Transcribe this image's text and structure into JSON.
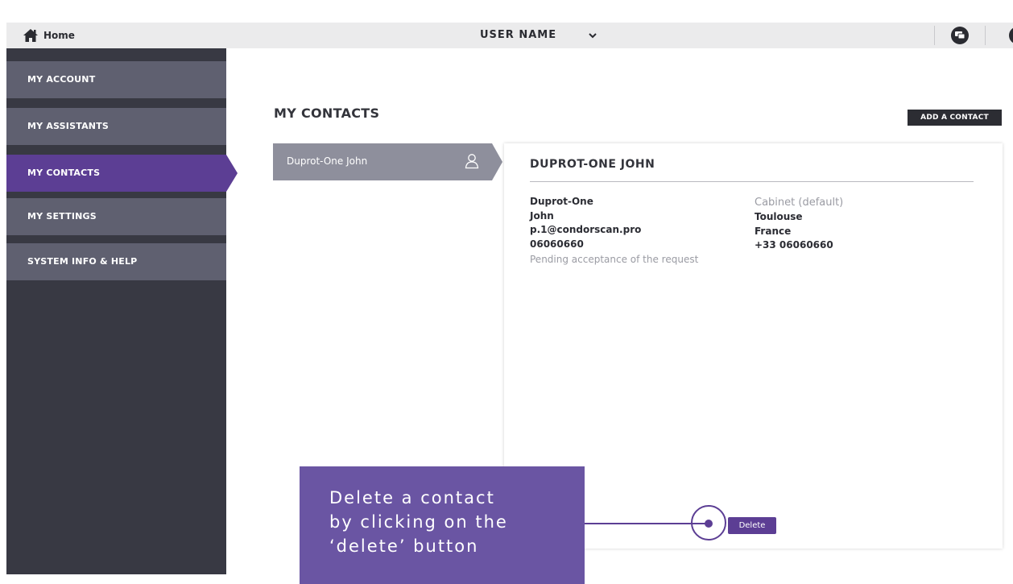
{
  "topbar": {
    "home_label": "Home",
    "user_name": "USER NAME",
    "icons": {
      "home": "home-icon",
      "chevron": "chevron-down-icon",
      "chat": "chat-icon",
      "profile": "profile-icon"
    }
  },
  "sidebar": {
    "items": [
      {
        "label": "MY ACCOUNT",
        "active": false
      },
      {
        "label": "MY ASSISTANTS",
        "active": false
      },
      {
        "label": "MY CONTACTS",
        "active": true
      },
      {
        "label": "MY SETTINGS",
        "active": false
      },
      {
        "label": "SYSTEM INFO & HELP",
        "active": false
      }
    ]
  },
  "main": {
    "title": "MY CONTACTS",
    "add_contact_label": "ADD A CONTACT",
    "contact_list": [
      {
        "name": "Duprot-One John",
        "icon": "user-icon"
      }
    ],
    "detail": {
      "title": "DUPROT-ONE JOHN",
      "last_name": "Duprot-One",
      "first_name": "John",
      "email": "p.1@condorscan.pro",
      "phone": "06060660",
      "status": "Pending acceptance of the request",
      "cabinet_label": "Cabinet (default)",
      "city": "Toulouse",
      "country": "France",
      "cabinet_phone": "+33 06060660"
    },
    "delete_label": "Delete"
  },
  "callout": {
    "lines": [
      "Delete a contact",
      "by clicking on the",
      "‘delete’ button"
    ]
  },
  "colors": {
    "accent": "#5c3e94",
    "callout": "#6a55a3",
    "sidebar_bg": "#383943",
    "nav_item": "#5f6070",
    "contact_item": "#8e8f9c"
  }
}
